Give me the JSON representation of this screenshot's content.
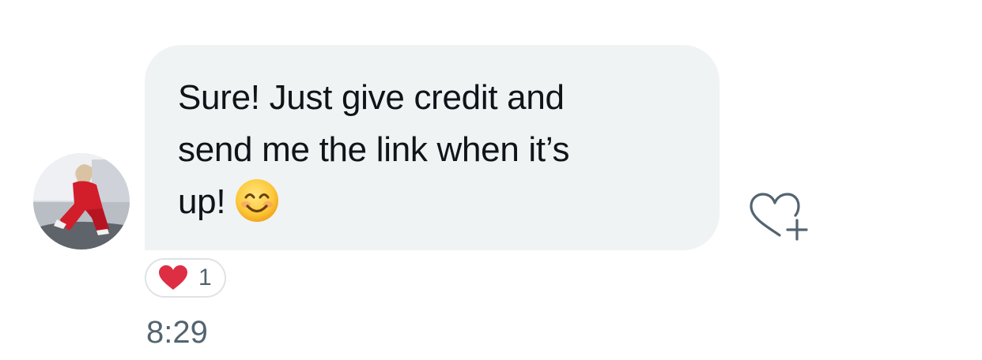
{
  "message": {
    "text": "Sure! Just give credit and\nsend me the link when it’s\nup!",
    "emoji": "smiling-face-emoji",
    "bubble_color": "#eff3f4",
    "text_color": "#0f1419"
  },
  "reaction": {
    "icon": "heart-icon",
    "color": "#e0245e",
    "count": "1"
  },
  "add_reaction_icon": "heart-plus-icon",
  "timestamp": "8:29",
  "meta_color": "#536471"
}
